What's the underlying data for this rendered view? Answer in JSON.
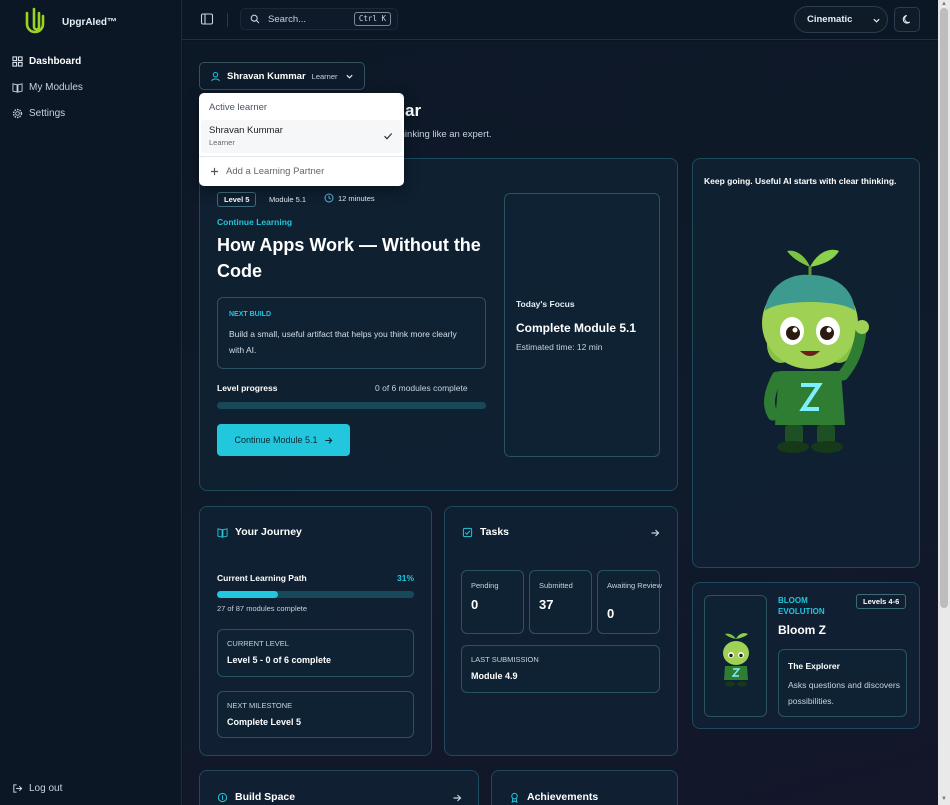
{
  "app": {
    "name": "UpgrAIed™"
  },
  "sidebar": {
    "items": [
      {
        "label": "Dashboard",
        "icon": "dashboard-icon",
        "active": true
      },
      {
        "label": "My Modules",
        "icon": "book-icon",
        "active": false
      },
      {
        "label": "Settings",
        "icon": "gear-icon",
        "active": false
      }
    ],
    "logout": "Log out"
  },
  "topbar": {
    "search_label": "Search...",
    "search_shortcut": "Ctrl K",
    "theme_value": "Cinematic"
  },
  "learner_switch": {
    "name": "Shravan Kummar",
    "role": "Learner"
  },
  "dropdown": {
    "header": "Active learner",
    "item_name": "Shravan Kummar",
    "item_role": "Learner",
    "add_label": "Add a Learning Partner"
  },
  "hero": {
    "title_visible": "ar",
    "subtitle_visible": "thinking like an expert."
  },
  "continue_card": {
    "level_badge": "Level 5",
    "module": "Module 5.1",
    "duration": "12 minutes",
    "section_label": "Continue Learning",
    "title": "How Apps Work — Without the Code",
    "next_build_label": "NEXT BUILD",
    "next_build_text": "Build a small, useful artifact that helps you think more clearly with AI.",
    "progress_label": "Level progress",
    "progress_count": "0 of 6 modules complete",
    "progress_fraction": 0,
    "cta": "Continue Module 5.1"
  },
  "todays_focus": {
    "label": "Today's Focus",
    "title": "Complete Module 5.1",
    "estimate": "Estimated time: 12 min"
  },
  "mascot_card": {
    "quote": "Keep going. Useful AI starts with clear thinking."
  },
  "journey": {
    "title": "Your Journey",
    "path_label": "Current Learning Path",
    "percent_text": "31%",
    "percent": 31,
    "modules_text": "27 of 87 modules complete",
    "current_level_label": "CURRENT LEVEL",
    "current_level_value": "Level 5 - 0 of 6 complete",
    "next_milestone_label": "NEXT MILESTONE",
    "next_milestone_value": "Complete Level 5"
  },
  "tasks": {
    "title": "Tasks",
    "pending_label": "Pending",
    "pending_value": "0",
    "submitted_label": "Submitted",
    "submitted_value": "37",
    "awaiting_label": "Awaiting Review",
    "awaiting_value": "0",
    "last_label": "LAST SUBMISSION",
    "last_value": "Module 4.9"
  },
  "bloom": {
    "tag": "BLOOM EVOLUTION",
    "badge": "Levels 4-6",
    "name": "Bloom Z",
    "explorer_title": "The Explorer",
    "explorer_desc": "Asks questions and discovers possibilities."
  },
  "build_space": {
    "title": "Build Space"
  },
  "achievements": {
    "title": "Achievements"
  },
  "colors": {
    "accent": "#22c6dd",
    "background": "#0b1422",
    "card_border": "#1d4a5c"
  }
}
